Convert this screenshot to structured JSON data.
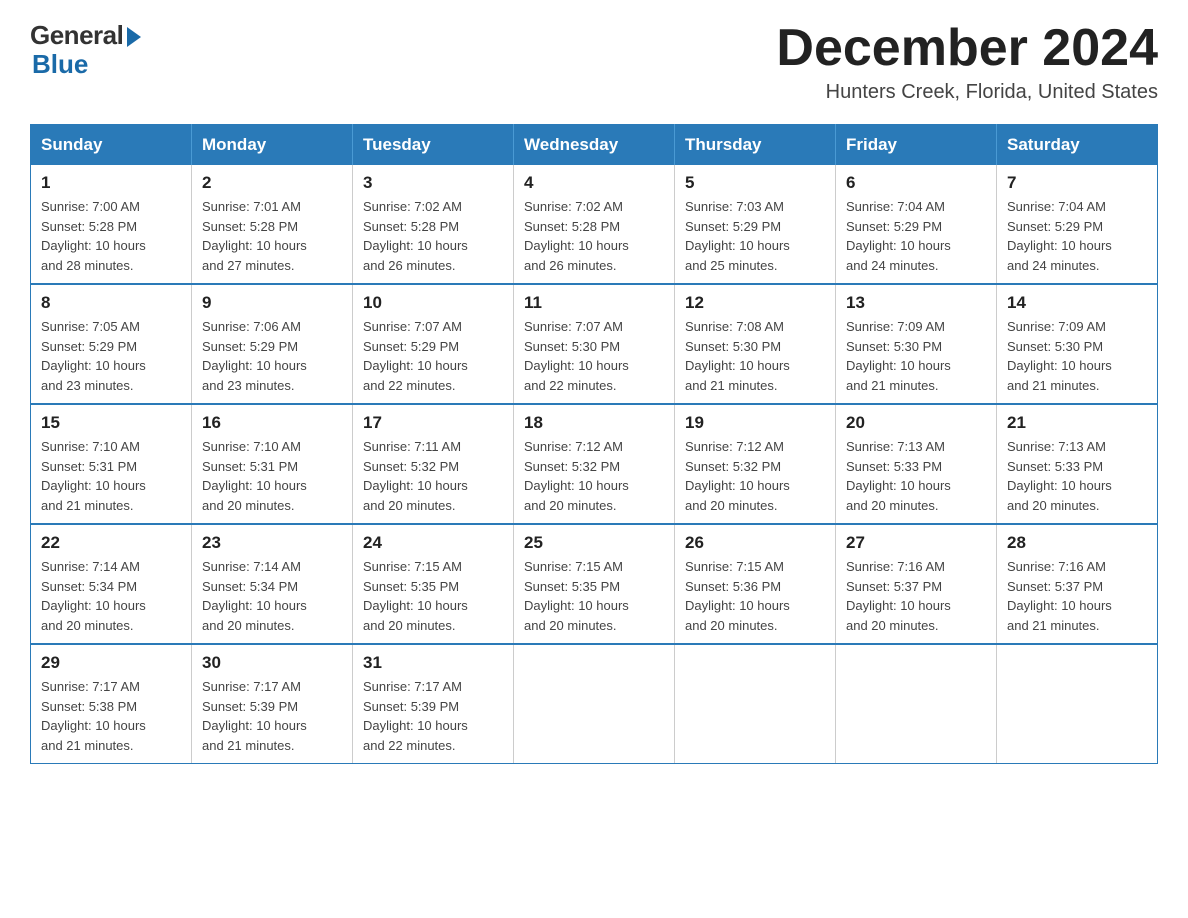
{
  "logo": {
    "general": "General",
    "blue": "Blue"
  },
  "header": {
    "title": "December 2024",
    "location": "Hunters Creek, Florida, United States"
  },
  "days_of_week": [
    "Sunday",
    "Monday",
    "Tuesday",
    "Wednesday",
    "Thursday",
    "Friday",
    "Saturday"
  ],
  "weeks": [
    [
      {
        "day": "1",
        "sunrise": "7:00 AM",
        "sunset": "5:28 PM",
        "daylight": "10 hours and 28 minutes."
      },
      {
        "day": "2",
        "sunrise": "7:01 AM",
        "sunset": "5:28 PM",
        "daylight": "10 hours and 27 minutes."
      },
      {
        "day": "3",
        "sunrise": "7:02 AM",
        "sunset": "5:28 PM",
        "daylight": "10 hours and 26 minutes."
      },
      {
        "day": "4",
        "sunrise": "7:02 AM",
        "sunset": "5:28 PM",
        "daylight": "10 hours and 26 minutes."
      },
      {
        "day": "5",
        "sunrise": "7:03 AM",
        "sunset": "5:29 PM",
        "daylight": "10 hours and 25 minutes."
      },
      {
        "day": "6",
        "sunrise": "7:04 AM",
        "sunset": "5:29 PM",
        "daylight": "10 hours and 24 minutes."
      },
      {
        "day": "7",
        "sunrise": "7:04 AM",
        "sunset": "5:29 PM",
        "daylight": "10 hours and 24 minutes."
      }
    ],
    [
      {
        "day": "8",
        "sunrise": "7:05 AM",
        "sunset": "5:29 PM",
        "daylight": "10 hours and 23 minutes."
      },
      {
        "day": "9",
        "sunrise": "7:06 AM",
        "sunset": "5:29 PM",
        "daylight": "10 hours and 23 minutes."
      },
      {
        "day": "10",
        "sunrise": "7:07 AM",
        "sunset": "5:29 PM",
        "daylight": "10 hours and 22 minutes."
      },
      {
        "day": "11",
        "sunrise": "7:07 AM",
        "sunset": "5:30 PM",
        "daylight": "10 hours and 22 minutes."
      },
      {
        "day": "12",
        "sunrise": "7:08 AM",
        "sunset": "5:30 PM",
        "daylight": "10 hours and 21 minutes."
      },
      {
        "day": "13",
        "sunrise": "7:09 AM",
        "sunset": "5:30 PM",
        "daylight": "10 hours and 21 minutes."
      },
      {
        "day": "14",
        "sunrise": "7:09 AM",
        "sunset": "5:30 PM",
        "daylight": "10 hours and 21 minutes."
      }
    ],
    [
      {
        "day": "15",
        "sunrise": "7:10 AM",
        "sunset": "5:31 PM",
        "daylight": "10 hours and 21 minutes."
      },
      {
        "day": "16",
        "sunrise": "7:10 AM",
        "sunset": "5:31 PM",
        "daylight": "10 hours and 20 minutes."
      },
      {
        "day": "17",
        "sunrise": "7:11 AM",
        "sunset": "5:32 PM",
        "daylight": "10 hours and 20 minutes."
      },
      {
        "day": "18",
        "sunrise": "7:12 AM",
        "sunset": "5:32 PM",
        "daylight": "10 hours and 20 minutes."
      },
      {
        "day": "19",
        "sunrise": "7:12 AM",
        "sunset": "5:32 PM",
        "daylight": "10 hours and 20 minutes."
      },
      {
        "day": "20",
        "sunrise": "7:13 AM",
        "sunset": "5:33 PM",
        "daylight": "10 hours and 20 minutes."
      },
      {
        "day": "21",
        "sunrise": "7:13 AM",
        "sunset": "5:33 PM",
        "daylight": "10 hours and 20 minutes."
      }
    ],
    [
      {
        "day": "22",
        "sunrise": "7:14 AM",
        "sunset": "5:34 PM",
        "daylight": "10 hours and 20 minutes."
      },
      {
        "day": "23",
        "sunrise": "7:14 AM",
        "sunset": "5:34 PM",
        "daylight": "10 hours and 20 minutes."
      },
      {
        "day": "24",
        "sunrise": "7:15 AM",
        "sunset": "5:35 PM",
        "daylight": "10 hours and 20 minutes."
      },
      {
        "day": "25",
        "sunrise": "7:15 AM",
        "sunset": "5:35 PM",
        "daylight": "10 hours and 20 minutes."
      },
      {
        "day": "26",
        "sunrise": "7:15 AM",
        "sunset": "5:36 PM",
        "daylight": "10 hours and 20 minutes."
      },
      {
        "day": "27",
        "sunrise": "7:16 AM",
        "sunset": "5:37 PM",
        "daylight": "10 hours and 20 minutes."
      },
      {
        "day": "28",
        "sunrise": "7:16 AM",
        "sunset": "5:37 PM",
        "daylight": "10 hours and 21 minutes."
      }
    ],
    [
      {
        "day": "29",
        "sunrise": "7:17 AM",
        "sunset": "5:38 PM",
        "daylight": "10 hours and 21 minutes."
      },
      {
        "day": "30",
        "sunrise": "7:17 AM",
        "sunset": "5:39 PM",
        "daylight": "10 hours and 21 minutes."
      },
      {
        "day": "31",
        "sunrise": "7:17 AM",
        "sunset": "5:39 PM",
        "daylight": "10 hours and 22 minutes."
      },
      null,
      null,
      null,
      null
    ]
  ],
  "labels": {
    "sunrise": "Sunrise: ",
    "sunset": "Sunset: ",
    "daylight": "Daylight: "
  }
}
